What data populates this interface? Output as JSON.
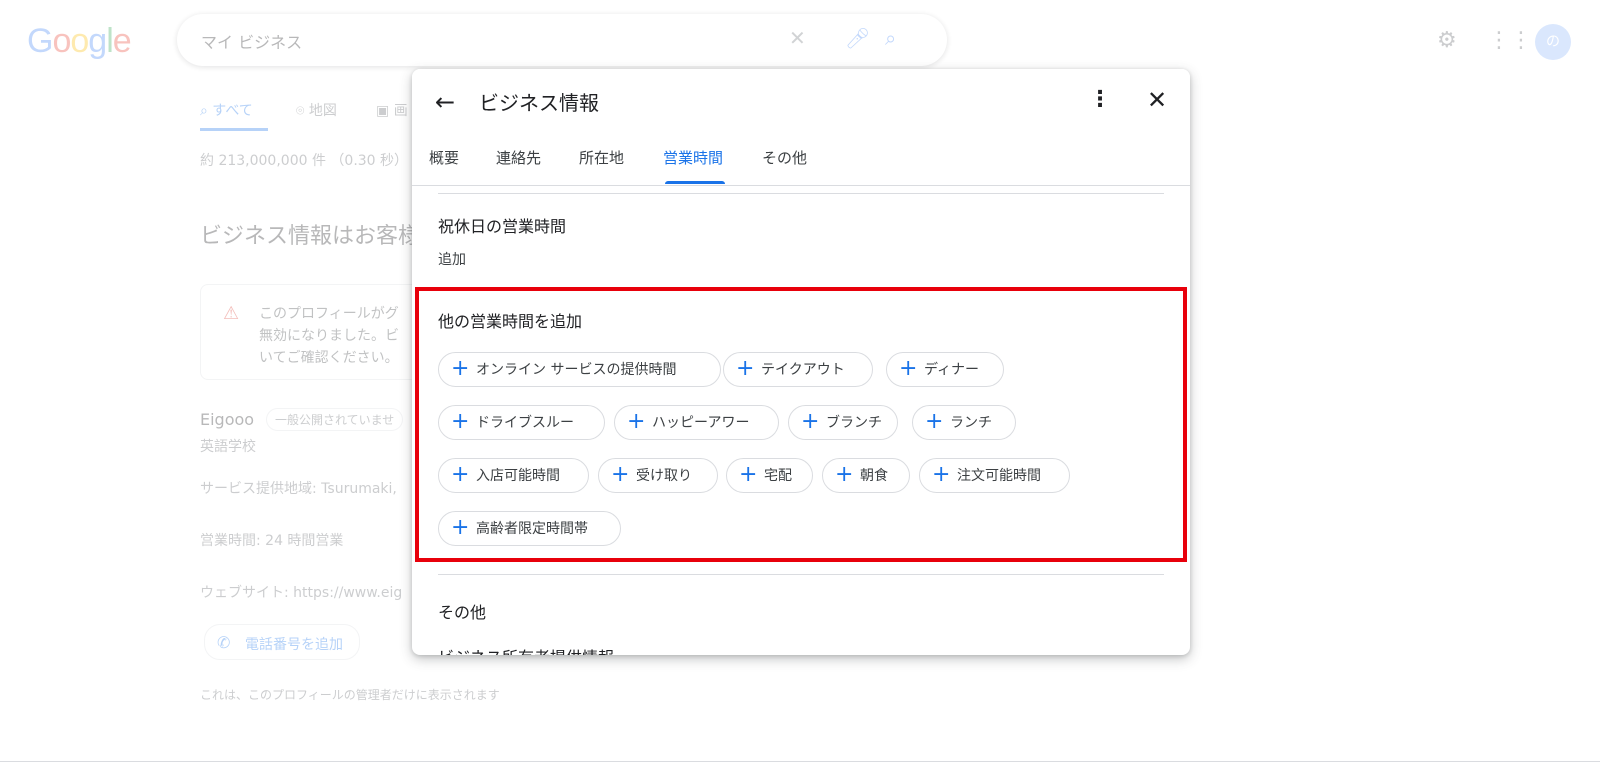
{
  "background": {
    "logo": "Google",
    "search_query": "マイ ビジネス",
    "tabs": [
      "すべて",
      "地図",
      "画"
    ],
    "results_stats": "約 213,000,000 件 （0.30 秒）",
    "heading": "ビジネス情報はお客様",
    "warning_text": "このプロフィールがグ\n無効になりました。ビ\nいてご確認ください。",
    "business_name": "Eigooo",
    "business_badge": "一般公開されていませ",
    "business_category": "英語学校",
    "service_area": "サービス提供地域: Tsurumaki,",
    "hours": "営業時間: 24 時間営業",
    "website": "ウェブサイト: https://www.eig",
    "phone_button": "電話番号を追加",
    "footer_note": "これは、このプロフィールの管理者だけに表示されます",
    "avatar_letter": "の"
  },
  "dialog": {
    "title": "ビジネス情報",
    "tabs": [
      {
        "label": "概要"
      },
      {
        "label": "連絡先"
      },
      {
        "label": "所在地"
      },
      {
        "label": "営業時間",
        "active": true
      },
      {
        "label": "その他"
      }
    ],
    "holiday_hours": {
      "title": "祝休日の営業時間",
      "action": "追加"
    },
    "more_hours": {
      "title": "他の営業時間を追加",
      "chips": [
        "オンライン サービスの提供時間",
        "テイクアウト",
        "ディナー",
        "ドライブスルー",
        "ハッピーアワー",
        "ブランチ",
        "ランチ",
        "入店可能時間",
        "受け取り",
        "宅配",
        "朝食",
        "注文可能時間",
        "高齢者限定時間帯"
      ]
    },
    "other": {
      "title": "その他",
      "cut_text": "ビジネス所有者提供情報"
    }
  },
  "colors": {
    "accent": "#1a73e8",
    "highlight_box": "#e8000b"
  }
}
